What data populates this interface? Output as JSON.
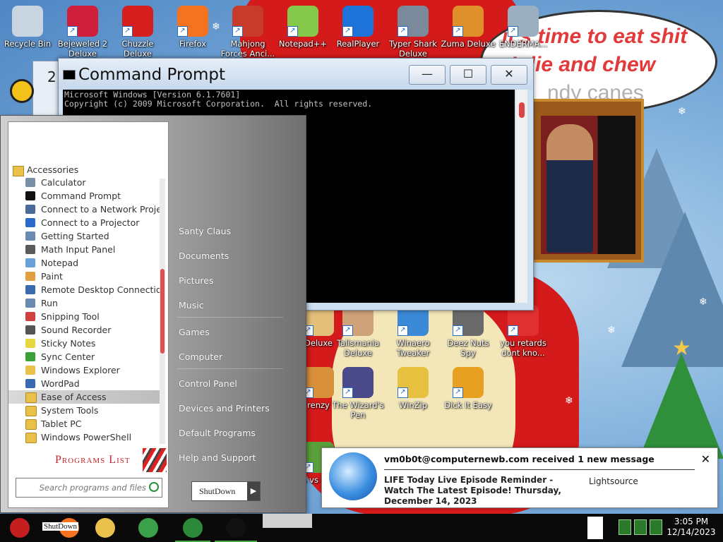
{
  "desktop_icons": [
    {
      "label": "Recycle Bin",
      "icon": "recycle-bin-icon",
      "color": "#c8d4e0"
    },
    {
      "label": "Bejeweled 2 Deluxe",
      "icon": "bejeweled-icon",
      "color": "#d01f3a"
    },
    {
      "label": "Chuzzle Deluxe",
      "icon": "chuzzle-icon",
      "color": "#d61e1e"
    },
    {
      "label": "Firefox",
      "icon": "firefox-icon",
      "color": "#f5731f"
    },
    {
      "label": "Mahjong Forces Anci...",
      "icon": "mahjong-icon",
      "color": "#c83a2a"
    },
    {
      "label": "Notepad++",
      "icon": "notepad-plus-plus-icon",
      "color": "#86c94a"
    },
    {
      "label": "RealPlayer",
      "icon": "realplayer-icon",
      "color": "#1e73d8"
    },
    {
      "label": "Typer Shark Deluxe",
      "icon": "typer-shark-icon",
      "color": "#7a8a9a"
    },
    {
      "label": "Zuma Deluxe",
      "icon": "zuma-icon",
      "color": "#e0902a"
    },
    {
      "label": "ENDERMA...",
      "icon": "enderma-icon",
      "color": "#9ab0c0"
    },
    {
      "label": "Deluxe",
      "icon": "deluxe-game-icon",
      "color": "#e3c07a"
    },
    {
      "label": "Talismania Deluxe",
      "icon": "talismania-icon",
      "color": "#cfa27a"
    },
    {
      "label": "Winaero Tweaker",
      "icon": "winaero-icon",
      "color": "#3a8ad8"
    },
    {
      "label": "Deez Nuts Spy",
      "icon": "deez-nuts-icon",
      "color": "#6a6a6a"
    },
    {
      "label": "you retards dont kno...",
      "icon": "no-sign-icon",
      "color": "#e03030"
    },
    {
      "label": "renzy",
      "icon": "frenzy-icon",
      "color": "#d8903a"
    },
    {
      "label": "The Wizard's Pen",
      "icon": "wizard-icon",
      "color": "#4a4a8a"
    },
    {
      "label": "WinZip",
      "icon": "winzip-icon",
      "color": "#e8c040"
    },
    {
      "label": "Dick It Easy",
      "icon": "dick-it-easy-icon",
      "color": "#e8a020"
    },
    {
      "label": "rs vs bies",
      "icon": "plants-icon",
      "color": "#5aa03a"
    }
  ],
  "bubble": {
    "lines": [
      "it's time to eat shit",
      "I die and chew",
      "ndy canes"
    ]
  },
  "cmd": {
    "title": "Command Prompt",
    "lines": [
      "Microsoft Windows [Version 6.1.7601]",
      "Copyright (c) 2009 Microsoft Corporation.  All rights reserved."
    ],
    "buttons": {
      "minimize": "—",
      "maximize": "☐",
      "close": "✕"
    }
  },
  "bg_window": {
    "title_fragment": "2"
  },
  "start_menu": {
    "folder": "Accessories",
    "programs": [
      {
        "label": "Calculator",
        "icon": "calculator-icon",
        "color": "#7a8fa8",
        "folder": false
      },
      {
        "label": "Command Prompt",
        "icon": "command-prompt-icon",
        "color": "#111111",
        "folder": false
      },
      {
        "label": "Connect to a Network Projector",
        "icon": "network-projector-icon",
        "color": "#4a6a9a",
        "folder": false
      },
      {
        "label": "Connect to a Projector",
        "icon": "projector-icon",
        "color": "#2a6ac8",
        "folder": false
      },
      {
        "label": "Getting Started",
        "icon": "getting-started-icon",
        "color": "#6a8ab0",
        "folder": false
      },
      {
        "label": "Math Input Panel",
        "icon": "math-input-icon",
        "color": "#5a5a5a",
        "folder": false
      },
      {
        "label": "Notepad",
        "icon": "notepad-icon",
        "color": "#6aa0d8",
        "folder": false
      },
      {
        "label": "Paint",
        "icon": "paint-icon",
        "color": "#e0a040",
        "folder": false
      },
      {
        "label": "Remote Desktop Connection",
        "icon": "remote-desktop-icon",
        "color": "#3a6ab0",
        "folder": false
      },
      {
        "label": "Run",
        "icon": "run-icon",
        "color": "#6a8ab0",
        "folder": false
      },
      {
        "label": "Snipping Tool",
        "icon": "snipping-tool-icon",
        "color": "#d04040",
        "folder": false
      },
      {
        "label": "Sound Recorder",
        "icon": "sound-recorder-icon",
        "color": "#555555",
        "folder": false
      },
      {
        "label": "Sticky Notes",
        "icon": "sticky-notes-icon",
        "color": "#e8d840",
        "folder": false
      },
      {
        "label": "Sync Center",
        "icon": "sync-center-icon",
        "color": "#3aa03a",
        "folder": false
      },
      {
        "label": "Windows Explorer",
        "icon": "windows-explorer-icon",
        "color": "#e8c04a",
        "folder": false
      },
      {
        "label": "WordPad",
        "icon": "wordpad-icon",
        "color": "#3a6ab0",
        "folder": false
      },
      {
        "label": "Ease of Access",
        "icon": "folder-icon",
        "color": "#e8c04a",
        "folder": true,
        "highlight": true
      },
      {
        "label": "System Tools",
        "icon": "folder-icon",
        "color": "#e8c04a",
        "folder": true
      },
      {
        "label": "Tablet PC",
        "icon": "folder-icon",
        "color": "#e8c04a",
        "folder": true
      },
      {
        "label": "Windows PowerShell",
        "icon": "folder-icon",
        "color": "#e8c04a",
        "folder": true
      }
    ],
    "programs_list_label": "Programs List",
    "search_placeholder": "Search programs and files",
    "right_items": [
      "Santy Claus",
      "Documents",
      "Pictures",
      "Music",
      "Games",
      "Computer",
      "Control Panel",
      "Devices and Printers",
      "Default Programs",
      "Help and Support"
    ],
    "shutdown_label": "ShutDown"
  },
  "notification": {
    "header": "vm0b0t@computernewb.com received 1 new message",
    "body": "LIFE Today Live Episode Reminder - Watch The Latest Episode! Thursday, December 14, 2023",
    "source": "Lightsource",
    "close": "✕"
  },
  "taskbar": {
    "items": [
      {
        "name": "start-orb",
        "icon": "santa-icon",
        "color": "#c41e1e"
      },
      {
        "name": "shutdown-firefox",
        "icon": "firefox-icon",
        "color": "#f5731f",
        "label": "ShutDown"
      },
      {
        "name": "explorer",
        "icon": "folder-icon",
        "color": "#e8c04a"
      },
      {
        "name": "chrome",
        "icon": "chrome-icon",
        "color": "#3aa04a"
      },
      {
        "name": "tree-app",
        "icon": "christmas-tree-icon",
        "color": "#2a8a3a"
      },
      {
        "name": "cmd-app",
        "icon": "command-prompt-icon",
        "color": "#111111"
      }
    ],
    "clock_time": "3:05 PM",
    "clock_date": "12/14/2023"
  }
}
